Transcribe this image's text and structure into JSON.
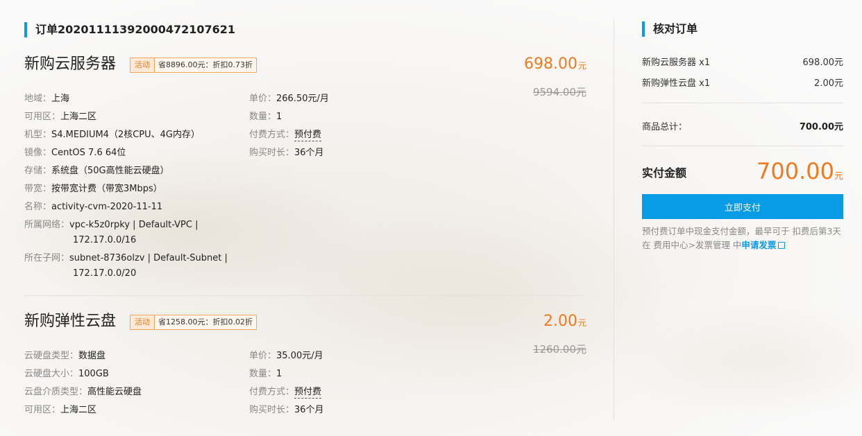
{
  "order": {
    "title": "订单20201111392000472107621"
  },
  "products": [
    {
      "title": "新购云服务器",
      "promo_tag": "活动",
      "promo_text": "省8896.00元：折扣0.73折",
      "price": "698.00",
      "price_unit": "元",
      "original_price": "9594.00元",
      "left_specs": [
        {
          "k": "地域：",
          "v": "上海"
        },
        {
          "k": "可用区：",
          "v": "上海二区"
        },
        {
          "k": "机型：",
          "v": "S4.MEDIUM4（2核CPU、4G内存）"
        },
        {
          "k": "镜像：",
          "v": "CentOS 7.6 64位"
        },
        {
          "k": "存储：",
          "v": "系统盘（50G高性能云硬盘）"
        },
        {
          "k": "带宽：",
          "v": "按带宽计费（带宽3Mbps）"
        },
        {
          "k": "名称：",
          "v": "activity-cvm-2020-11-11"
        }
      ],
      "network": {
        "k": "所属网络：",
        "v1": "vpc-k5z0rpky | Default-VPC |",
        "v2": "172.17.0.0/16"
      },
      "subnet": {
        "k": "所在子网：",
        "v1": "subnet-8736olzv | Default-Subnet |",
        "v2": "172.17.0.0/20"
      },
      "right_specs": [
        {
          "k": "单价：",
          "v": "266.50元/月"
        },
        {
          "k": "数量：",
          "v": "1"
        },
        {
          "k": "付费方式：",
          "v": "预付费"
        },
        {
          "k": "购买时长：",
          "v": "36个月"
        }
      ]
    },
    {
      "title": "新购弹性云盘",
      "promo_tag": "活动",
      "promo_text": "省1258.00元：折扣0.02折",
      "price": "2.00",
      "price_unit": "元",
      "original_price": "1260.00元",
      "left_specs": [
        {
          "k": "云硬盘类型：",
          "v": "数据盘"
        },
        {
          "k": "云硬盘大小：",
          "v": "100GB"
        },
        {
          "k": "云盘介质类型：",
          "v": "高性能云硬盘"
        },
        {
          "k": "可用区：",
          "v": "上海二区"
        }
      ],
      "right_specs": [
        {
          "k": "单价：",
          "v": "35.00元/月"
        },
        {
          "k": "数量：",
          "v": "1"
        },
        {
          "k": "付费方式：",
          "v": "预付费"
        },
        {
          "k": "购买时长：",
          "v": "36个月"
        }
      ]
    }
  ],
  "summary": {
    "title": "核对订单",
    "items": [
      {
        "name": "新购云服务器 x1",
        "price": "698.00元"
      },
      {
        "name": "新购弹性云盘 x1",
        "price": "2.00元"
      }
    ],
    "subtotal_label": "商品总计：",
    "subtotal_value": "700.00元",
    "total_label": "实付金额",
    "total_value": "700.00",
    "total_unit": "元",
    "pay_button": "立即支付",
    "note_text": "预付费订单中现金支付金额，最早可于 扣费后第3天 在 费用中心>发票管理 中",
    "note_link": "申请发票"
  },
  "colors": {
    "accent": "#0a9be6",
    "price": "#ed7b1e"
  },
  "icons": {
    "external_link": "external-link-icon"
  }
}
